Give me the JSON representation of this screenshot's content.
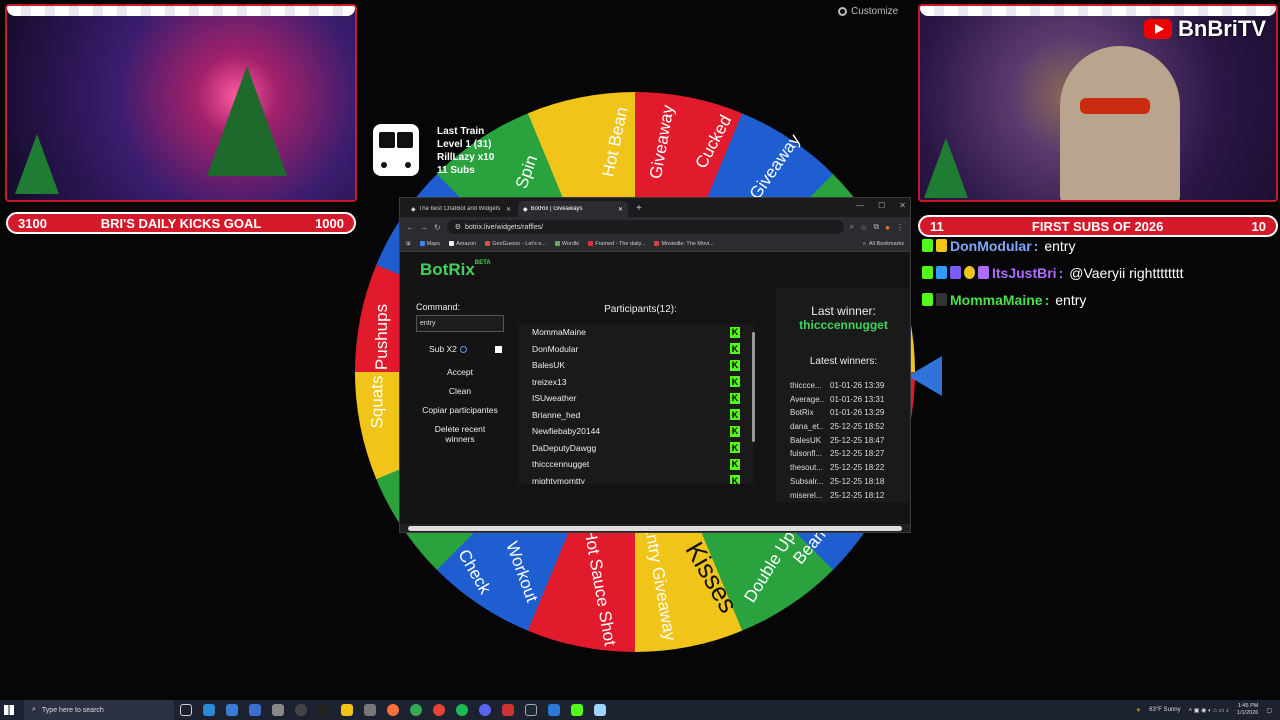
{
  "left_cam": {
    "goal_left": "3100",
    "goal_title": "BRI'S DAILY KICKS GOAL",
    "goal_right": "1000"
  },
  "right_cam": {
    "brand": "BnBriTV",
    "goal_left": "11",
    "goal_title": "FIRST SUBS OF 2026",
    "goal_right": "10"
  },
  "customize_label": "Customize",
  "train": {
    "title": "Last Train",
    "level": "Level 1",
    "level_count": "(31)",
    "user": "RillLazy x10",
    "subs": "11 Subs"
  },
  "wheel_labels": [
    "Hot Bean",
    "Giveaway",
    "Cucked",
    "Giveaway",
    "Spin",
    "Kisses",
    "Double Up",
    "Bean",
    "Entry Giveaway",
    "Hot Sauce Shot",
    "Workout",
    "Check",
    "Squats",
    "Pushups"
  ],
  "browser": {
    "tabs": [
      {
        "label": "The best ChatBot and Widgets",
        "active": false
      },
      {
        "label": "BotRix | Giveaways",
        "active": true
      }
    ],
    "address": "botrix.live/widgets/raffles/",
    "bookmarks": [
      {
        "label": "Maps",
        "color": "#4285f4"
      },
      {
        "label": "Amazon",
        "color": "#f0f0f0"
      },
      {
        "label": "GeoGuessr - Let's e...",
        "color": "#e34d4d"
      },
      {
        "label": "Wordle",
        "color": "#6aaa64"
      },
      {
        "label": "Framed - The daily...",
        "color": "#d33"
      },
      {
        "label": "Moviedle: The Movi...",
        "color": "#c44"
      }
    ],
    "all_bookmarks": "All Bookmarks"
  },
  "botrix": {
    "brand": "BotRix",
    "beta": "BETA",
    "command_label": "Command:",
    "command_value": "entry",
    "sub_label": "Sub X2",
    "buttons": {
      "accept": "Accept",
      "clean": "Clean",
      "copy": "Copiar participantes",
      "delete": "Delete recent winners"
    },
    "participants_title": "Participants(12):",
    "participants": [
      "MommaMaine",
      "DonModular",
      "BalesUK",
      "treizex13",
      "ISUweather",
      "Brianne_hed",
      "Newfiebaby20144",
      "DaDeputyDawgg",
      "thicccennugget",
      "mightymomtty"
    ],
    "last_winner_label": "Last winner:",
    "last_winner": "thicccennugget",
    "latest_winners_label": "Latest winners:",
    "winners": [
      {
        "name": "thiccce...",
        "time": "01-01-26 13:39"
      },
      {
        "name": "Average...",
        "time": "01-01-26 13:31"
      },
      {
        "name": "BotRix",
        "time": "01-01-26 13:29"
      },
      {
        "name": "dana_et...",
        "time": "25-12-25 18:52"
      },
      {
        "name": "BalesUK",
        "time": "25-12-25 18:47"
      },
      {
        "name": "fuisonfl...",
        "time": "25-12-25 18:27"
      },
      {
        "name": "thesout...",
        "time": "25-12-25 18:22"
      },
      {
        "name": "Subsalr...",
        "time": "25-12-25 18:18"
      },
      {
        "name": "miserel...",
        "time": "25-12-25 18:12"
      }
    ]
  },
  "chat": [
    {
      "user": "DonModular",
      "color": "#7fa7ff",
      "sep": ":",
      "msg": "entry"
    },
    {
      "user": "ItsJustBri",
      "color": "#b06cff",
      "sep": ":",
      "msg": "@Vaeryii rightttttttt"
    },
    {
      "user": "MommaMaine",
      "color": "#4ce04c",
      "sep": ":",
      "msg": "entry"
    }
  ],
  "taskbar": {
    "search_placeholder": "Type here to search",
    "weather": "63°F Sunny",
    "time": "1:45 PM",
    "date": "1/1/2026"
  }
}
